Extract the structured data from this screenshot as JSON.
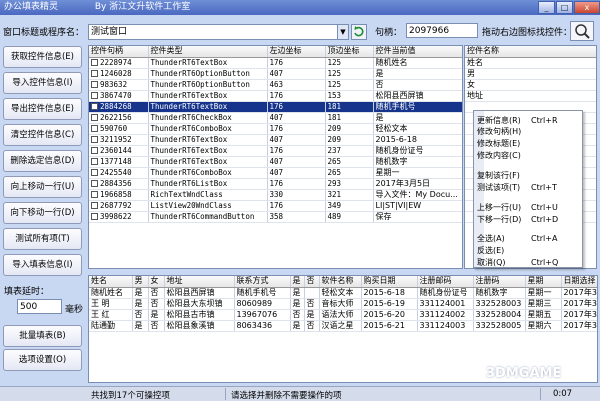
{
  "app": {
    "title": "办公填表精灵",
    "subtitle": "By 浙江文升软件工作室",
    "window_buttons": [
      "_",
      "□",
      "x"
    ]
  },
  "toolbar": {
    "window_label": "窗口标题或程序名：",
    "window_value": "测试窗口",
    "handle_label": "句柄：",
    "handle_value": "2097966",
    "drag_label": "拖动右边图标找控件："
  },
  "left_buttons": [
    {
      "name": "get-control-info-button",
      "label": "获取控件信息(E)"
    },
    {
      "name": "import-control-info-button",
      "label": "导入控件信息(I)"
    },
    {
      "name": "export-control-info-button",
      "label": "导出控件信息(E)"
    },
    {
      "name": "clear-control-info-button",
      "label": "清空控件信息(C)"
    },
    {
      "name": "delete-selected-button",
      "label": "删除选定信息(D)"
    },
    {
      "name": "move-up-button",
      "label": "向上移动一行(U)"
    },
    {
      "name": "move-down-button",
      "label": "向下移动一行(D)"
    },
    {
      "name": "test-all-button",
      "label": "测试所有项(T)"
    },
    {
      "name": "import-form-info-button",
      "label": "导入填表信息(I)"
    }
  ],
  "delay": {
    "label": "填表延时：",
    "value": "500",
    "unit": "毫秒"
  },
  "bottom_buttons": [
    {
      "name": "batch-fill-button",
      "label": "批量填表(B)"
    },
    {
      "name": "options-button",
      "label": "选项设置(O)"
    }
  ],
  "control_table": {
    "headers": [
      "控件句柄",
      "控件类型",
      "左边坐标",
      "顶边坐标",
      "控件当前值"
    ],
    "rows": [
      {
        "checked": true,
        "handle": "2228974",
        "type": "ThunderRT6TextBox",
        "left": "176",
        "top": "125",
        "value": "随机姓名"
      },
      {
        "checked": true,
        "handle": "1246028",
        "type": "ThunderRT6OptionButton",
        "left": "407",
        "top": "125",
        "value": "是"
      },
      {
        "checked": true,
        "handle": "983632",
        "type": "ThunderRT6OptionButton",
        "left": "463",
        "top": "125",
        "value": "否"
      },
      {
        "checked": true,
        "handle": "3867470",
        "type": "ThunderRT6TextBox",
        "left": "176",
        "top": "153",
        "value": "松阳县西屏镇"
      },
      {
        "checked": true,
        "handle": "2884268",
        "type": "ThunderRT6TextBox",
        "left": "176",
        "top": "181",
        "value": "随机手机号",
        "selected": true
      },
      {
        "checked": true,
        "handle": "2622156",
        "type": "ThunderRT6CheckBox",
        "left": "407",
        "top": "181",
        "value": "是"
      },
      {
        "checked": true,
        "handle": "590760",
        "type": "ThunderRT6ComboBox",
        "left": "176",
        "top": "209",
        "value": "轻松文本"
      },
      {
        "checked": true,
        "handle": "3211952",
        "type": "ThunderRT6TextBox",
        "left": "407",
        "top": "209",
        "value": "2015-6-18"
      },
      {
        "checked": true,
        "handle": "2360144",
        "type": "ThunderRT6TextBox",
        "left": "176",
        "top": "237",
        "value": "随机身份证号"
      },
      {
        "checked": true,
        "handle": "1377148",
        "type": "ThunderRT6TextBox",
        "left": "407",
        "top": "265",
        "value": "随机数字"
      },
      {
        "checked": true,
        "handle": "2425540",
        "type": "ThunderRT6ComboBox",
        "left": "407",
        "top": "265",
        "value": "星期一"
      },
      {
        "checked": true,
        "handle": "2884356",
        "type": "ThunderRT6ListBox",
        "left": "176",
        "top": "293",
        "value": "2017年3月5日"
      },
      {
        "checked": true,
        "handle": "1966858",
        "type": "RichTextWndClass",
        "left": "330",
        "top": "321",
        "value": "导入文件：My Docu..."
      },
      {
        "checked": true,
        "handle": "2687792",
        "type": "ListView20WndClass",
        "left": "176",
        "top": "349",
        "value": "LI|ST|VI|EW"
      },
      {
        "checked": true,
        "handle": "3998622",
        "type": "ThunderRT6CommandButton",
        "left": "358",
        "top": "489",
        "value": "保存"
      }
    ]
  },
  "name_table": {
    "header": "控件名称",
    "rows": [
      "姓名",
      "男",
      "女",
      "地址",
      "",
      "",
      "",
      "",
      "",
      "",
      "",
      "",
      "",
      "",
      ""
    ]
  },
  "context_menu": {
    "items": [
      {
        "label": "更新信息(R)",
        "shortcut": "Ctrl+R",
        "name": "menu-update-info"
      },
      {
        "label": "修改句柄(H)",
        "shortcut": "",
        "name": "menu-edit-handle"
      },
      {
        "label": "修改标题(E)",
        "shortcut": "",
        "name": "menu-edit-title"
      },
      {
        "label": "修改内容(C)",
        "shortcut": "",
        "name": "menu-edit-content"
      },
      {
        "label": "复制该行(F)",
        "shortcut": "",
        "name": "menu-copy-row"
      },
      {
        "label": "测试该项(T)",
        "shortcut": "Ctrl+T",
        "name": "menu-test-item"
      },
      {
        "label": "上移一行(U)",
        "shortcut": "Ctrl+U",
        "name": "menu-move-up"
      },
      {
        "label": "下移一行(D)",
        "shortcut": "Ctrl+D",
        "name": "menu-move-down"
      },
      {
        "label": "全选(A)",
        "shortcut": "Ctrl+A",
        "name": "menu-select-all"
      },
      {
        "label": "反选(E)",
        "shortcut": "",
        "name": "menu-invert-select"
      },
      {
        "label": "取消(Q)",
        "shortcut": "Ctrl+Q",
        "name": "menu-cancel"
      }
    ]
  },
  "data_table": {
    "headers": [
      "姓名",
      "男",
      "女",
      "地址",
      "联系方式",
      "是",
      "否",
      "软件名称",
      "购买日期",
      "注册邮码",
      "注册码",
      "星期",
      "日期选择"
    ],
    "rows": [
      [
        "随机姓名",
        "是",
        "否",
        "松阳县西屏镇",
        "随机手机号",
        "是",
        "",
        "轻松文本",
        "2015-6-18",
        "随机身份证号",
        "随机数字",
        "星期一",
        "2017年3"
      ],
      [
        "王 明",
        "是",
        "否",
        "松阳县大东坝镇",
        "8060989",
        "是",
        "否",
        "音标大师",
        "2015-6-19",
        "331124001",
        "332528003",
        "星期三",
        "2017年3"
      ],
      [
        "王 红",
        "否",
        "是",
        "松阳县古市镇",
        "13967076",
        "否",
        "是",
        "语法大师",
        "2015-6-20",
        "331124002",
        "332528004",
        "星期五",
        "2017年3"
      ],
      [
        "陆通勤",
        "是",
        "否",
        "松阳县象溪镇",
        "8063436",
        "是",
        "否",
        "汉语之星",
        "2015-6-21",
        "331124003",
        "332528005",
        "星期六",
        "2017年3"
      ]
    ]
  },
  "status": {
    "count": "共找到17个可操控项",
    "hint": "请选择并删除不需要操作的项",
    "time": "0:07"
  },
  "watermark": "3DMGAME",
  "colors": {
    "selection": "#16348c",
    "background": "#c9d8f2",
    "title": "#4a68c0"
  }
}
